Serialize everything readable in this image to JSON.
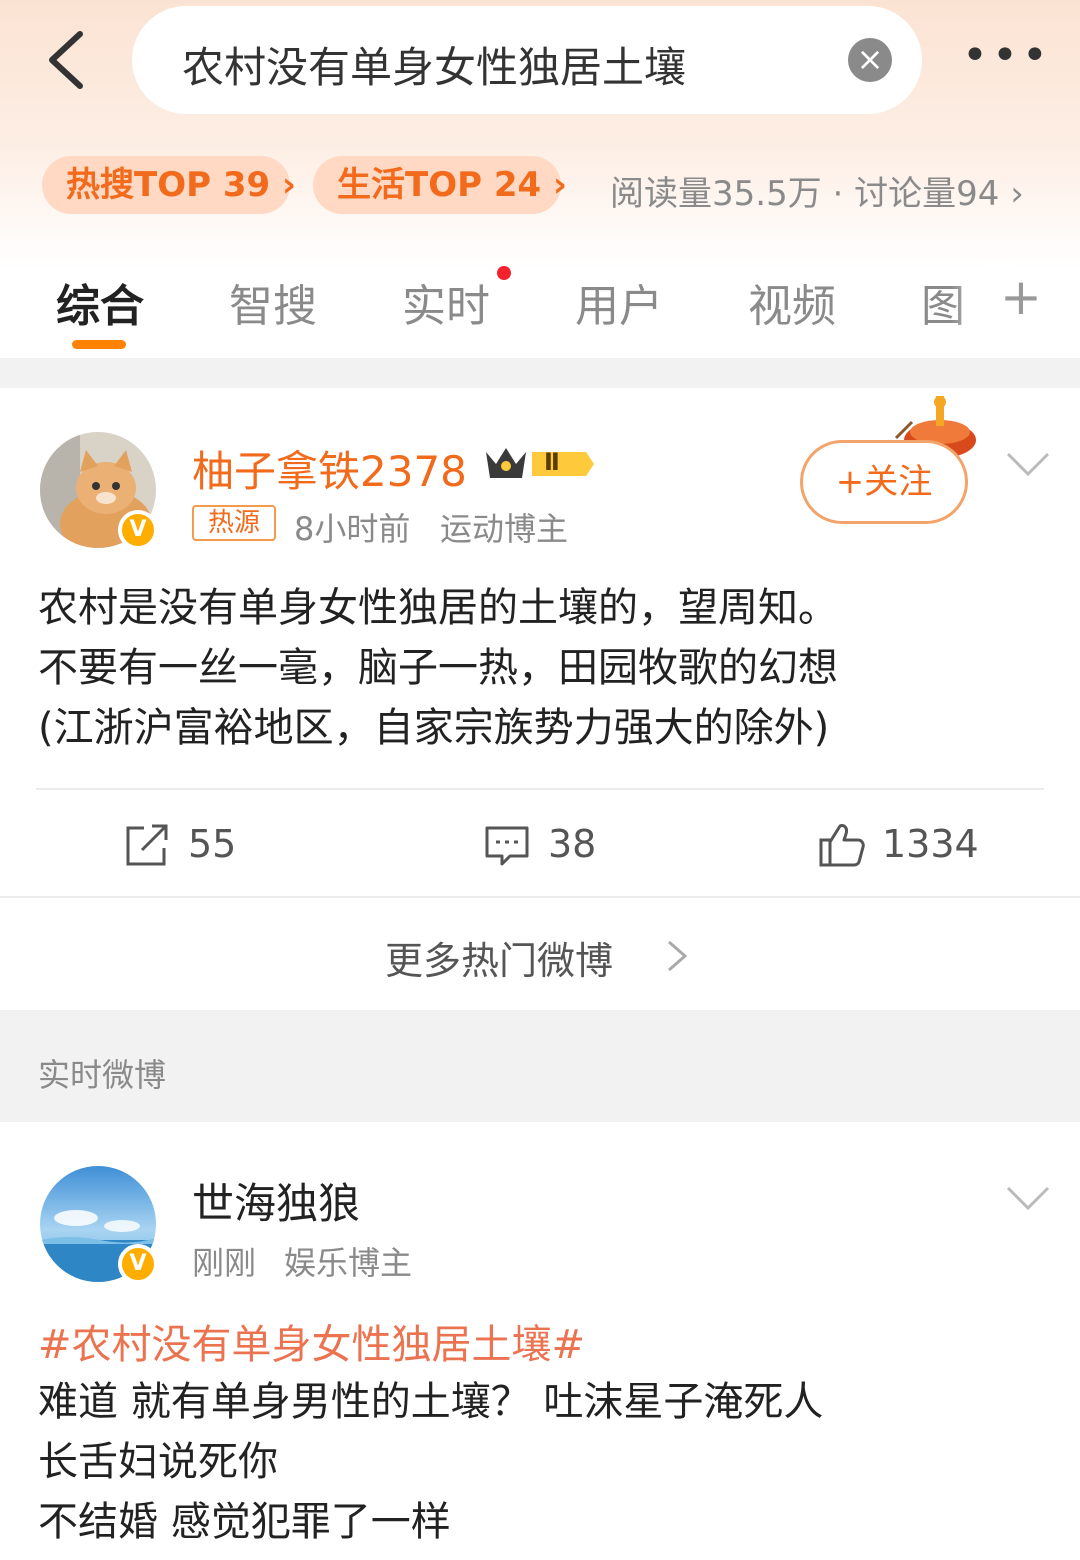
{
  "search": {
    "query": "农村没有单身女性独居土壤",
    "clear_icon": "×",
    "more_icon": "•••"
  },
  "ranks": [
    {
      "label": "热搜TOP 39 ›"
    },
    {
      "label": "生活TOP 24 ›"
    }
  ],
  "stats": "阅读量35.5万 · 讨论量94 ›",
  "tabs": [
    {
      "label": "综合",
      "active": true
    },
    {
      "label": "智搜"
    },
    {
      "label": "实时",
      "dot": true
    },
    {
      "label": "用户"
    },
    {
      "label": "视频"
    },
    {
      "label": "图"
    }
  ],
  "tab_more": "+",
  "post1": {
    "username": "柚子拿铁2378",
    "level_badge": "Ⅱ",
    "hot_tag": "热源",
    "time": "8小时前",
    "category": "运动博主",
    "follow_label": "+关注",
    "lines": [
      "农村是没有单身女性独居的土壤的，望周知。",
      "不要有一丝一毫，脑子一热，田园牧歌的幻想",
      "(江浙沪富裕地区，自家宗族势力强大的除外)"
    ],
    "reposts": "55",
    "comments": "38",
    "likes": "1334"
  },
  "more_hot": "更多热门微博",
  "realtime_section": "实时微博",
  "post2": {
    "username": "世海独狼",
    "time": "刚刚",
    "category": "娱乐博主",
    "hashtag": "#农村没有单身女性独居土壤#",
    "lines": [
      "难道  就有单身男性的土壤？  吐沫星子淹死人",
      "长舌妇说死你",
      "不结婚  感觉犯罪了一样"
    ]
  },
  "colors": {
    "accent": "#ff8200",
    "rank_text": "#f26a1b",
    "hashtag": "#eb7350",
    "username_vip": "#f26a1b"
  }
}
